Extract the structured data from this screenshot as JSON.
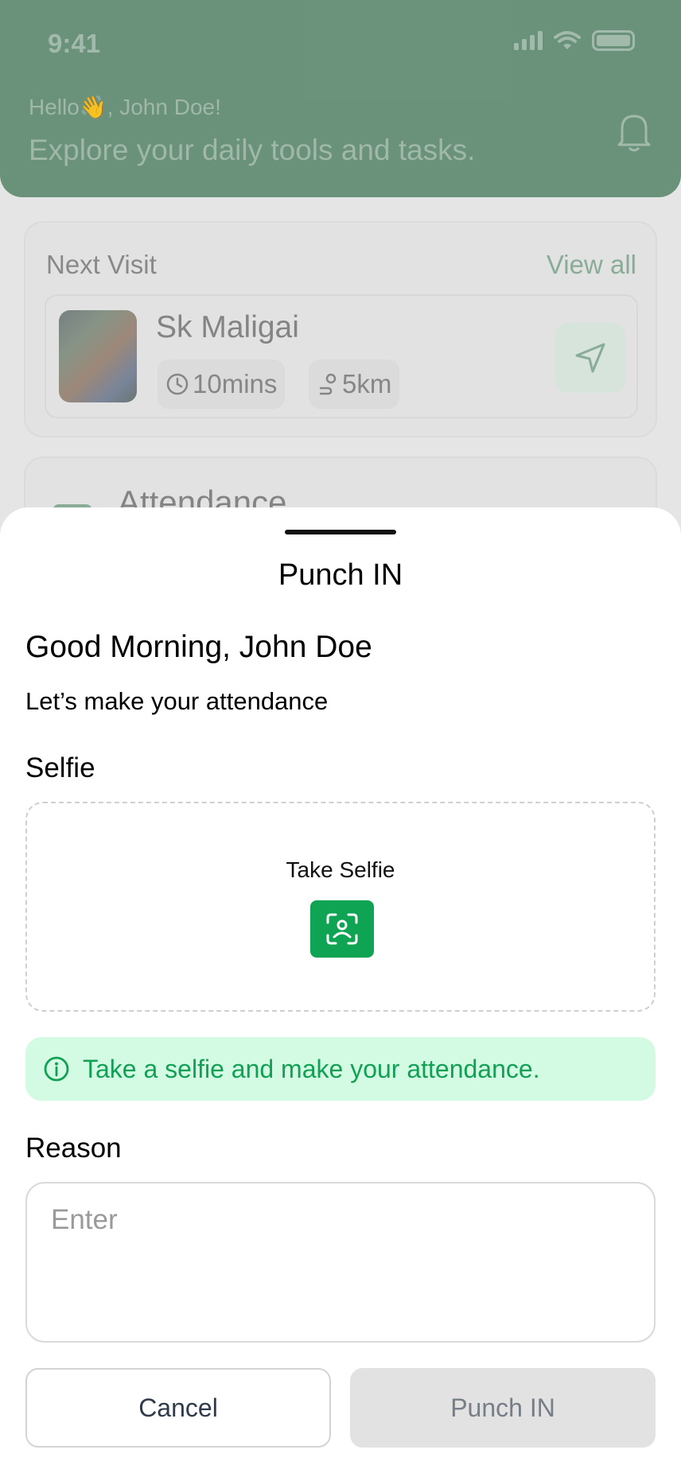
{
  "status_bar": {
    "time": "9:41"
  },
  "header": {
    "greeting": "Hello👋, John Doe!",
    "tagline": "Explore your daily tools and tasks."
  },
  "next_visit": {
    "title": "Next Visit",
    "view_all": "View all",
    "shop_name": "Sk Maligai",
    "time_chip": "10mins",
    "distance_chip": "5km"
  },
  "attendance_card": {
    "label": "Attendance"
  },
  "sheet": {
    "title": "Punch IN",
    "greeting": "Good Morning, John Doe",
    "subtitle": "Let’s make your attendance",
    "selfie_label": "Selfie",
    "take_selfie": "Take Selfie",
    "info": "Take a selfie and make your attendance.",
    "reason_label": "Reason",
    "reason_placeholder": "Enter",
    "cancel": "Cancel",
    "punch_in": "Punch IN"
  },
  "colors": {
    "header_green": "#6f9880",
    "accent_green": "#0fa453",
    "info_bg": "#d3fbe4",
    "disabled_btn": "#e2e2e2"
  },
  "icons": [
    "bell-icon",
    "clock-icon",
    "distance-icon",
    "navigation-icon",
    "calendar-icon",
    "face-scan-icon",
    "info-icon"
  ]
}
